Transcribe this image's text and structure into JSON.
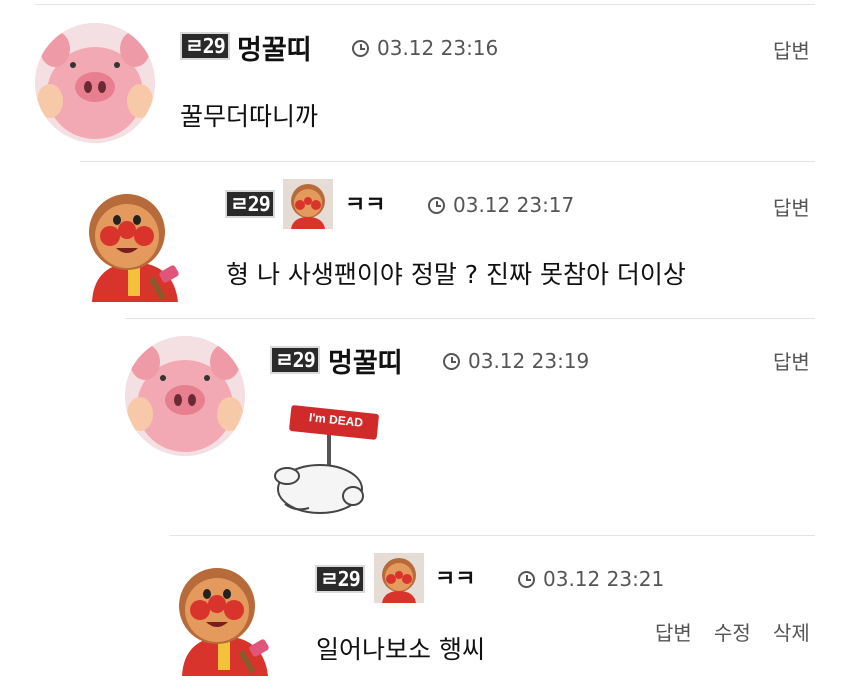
{
  "comments": [
    {
      "level": "ㄹ29",
      "nickname": "멍꿀띠",
      "timestamp": "03.12 23:16",
      "body": "꿀무더따니까",
      "actions": [
        "답변"
      ]
    },
    {
      "level": "ㄹ29",
      "nickname": "ㅋㅋ",
      "timestamp": "03.12 23:17",
      "body": "형 나 사생팬이야 정말 ? 진짜 못참아 더이상",
      "actions": [
        "답변"
      ]
    },
    {
      "level": "ㄹ29",
      "nickname": "멍꿀띠",
      "timestamp": "03.12 23:19",
      "sticker_text": "I'm DEAD",
      "actions": [
        "답변"
      ]
    },
    {
      "level": "ㄹ29",
      "nickname": "ㅋㅋ",
      "timestamp": "03.12 23:21",
      "body": "일어나보소 행씨",
      "actions": [
        "답변",
        "수정",
        "삭제"
      ]
    }
  ],
  "colors": {
    "text": "#111111",
    "meta": "#555555",
    "divider": "#e4e4e4",
    "badge_bg": "#2a2a2a"
  },
  "icons": [
    "pig-avatar",
    "anpanman-avatar",
    "clock-icon",
    "im-dead-sticker"
  ]
}
